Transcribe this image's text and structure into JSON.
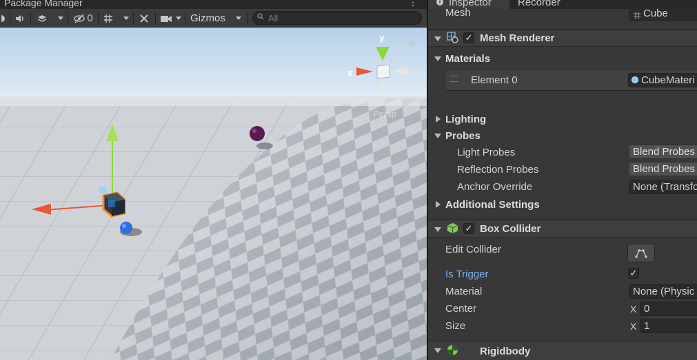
{
  "scene": {
    "title": "Package Manager",
    "toolbar": {
      "hidden_count": "0",
      "gizmos_label": "Gizmos",
      "search_placeholder": "All"
    },
    "orientation_gizmo": {
      "y_label": "y",
      "x_label": "x"
    },
    "projection_label": "Persp"
  },
  "inspector": {
    "tabs": [
      "Inspector",
      "Recorder"
    ],
    "mesh": {
      "label": "Mesh",
      "value": "Cube"
    },
    "mesh_renderer": {
      "title": "Mesh Renderer",
      "enabled": true,
      "materials_label": "Materials",
      "element_label": "Element 0",
      "element_value": "CubeMateri",
      "lighting_label": "Lighting",
      "probes_label": "Probes",
      "light_probes": {
        "label": "Light Probes",
        "value": "Blend Probes"
      },
      "reflection_probes": {
        "label": "Reflection Probes",
        "value": "Blend Probes"
      },
      "anchor_override": {
        "label": "Anchor Override",
        "value": "None (Transfo"
      },
      "additional_settings_label": "Additional Settings"
    },
    "box_collider": {
      "title": "Box Collider",
      "enabled": true,
      "edit_collider_label": "Edit Collider",
      "is_trigger": {
        "label": "Is Trigger",
        "checked": true
      },
      "material": {
        "label": "Material",
        "value": "None (Physic"
      },
      "center": {
        "label": "Center",
        "axis": "X",
        "value": "0"
      },
      "size": {
        "label": "Size",
        "axis": "X",
        "value": "1"
      }
    },
    "rigidbody": {
      "title": "Rigidbody"
    }
  },
  "colors": {
    "sky_top": "#b9d3ec",
    "horizon": "#e2e9ee",
    "floor_light": "#d2d6db",
    "floor_dark": "#a5abb2",
    "axis_x": "#e8573c",
    "axis_y": "#8ed63e",
    "axis_z": "#3d7fe0",
    "selection": "#f28a2a",
    "link_blue": "#7fb2ee"
  }
}
